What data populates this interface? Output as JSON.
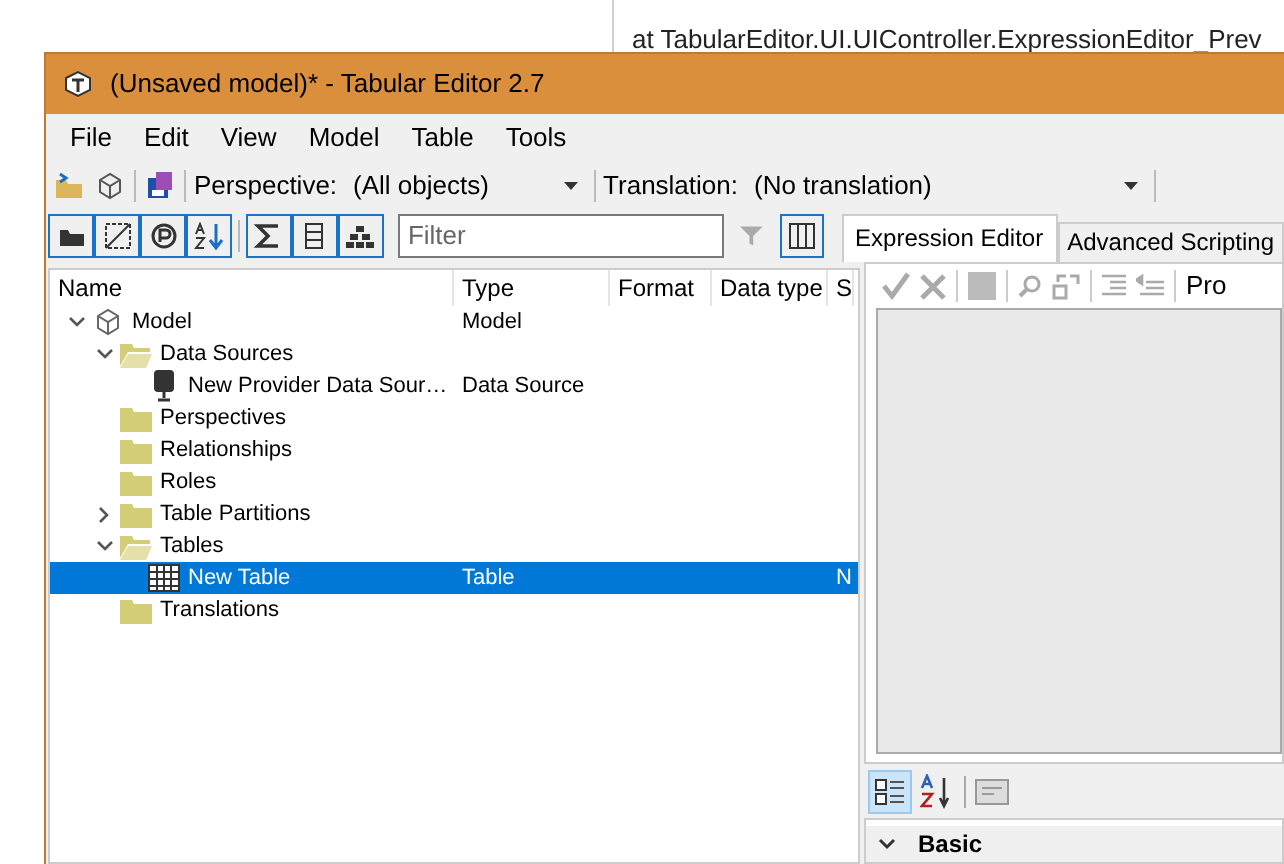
{
  "background_text": "at TabularEditor.UI.UIController.ExpressionEditor_Prev",
  "window": {
    "title": "(Unsaved model)* - Tabular Editor 2.7"
  },
  "menu": [
    "File",
    "Edit",
    "View",
    "Model",
    "Table",
    "Tools"
  ],
  "toolbar": {
    "perspective_label": "Perspective:",
    "perspective_value": "(All objects)",
    "translation_label": "Translation:",
    "translation_value": "(No translation)"
  },
  "filter": {
    "placeholder": "Filter"
  },
  "tree": {
    "columns": [
      "Name",
      "Type",
      "Format",
      "Data type",
      "S"
    ],
    "nodes": [
      {
        "kind": "model",
        "name": "Model",
        "type": "Model",
        "expanded": true,
        "selected": false,
        "children": [
          {
            "kind": "folder",
            "name": "Data Sources",
            "expanded": true,
            "selected": false,
            "children": [
              {
                "kind": "datasource",
                "name": "New Provider Data Sour…",
                "type": "Data Source",
                "selected": false
              }
            ]
          },
          {
            "kind": "folder",
            "name": "Perspectives",
            "selected": false
          },
          {
            "kind": "folder",
            "name": "Relationships",
            "selected": false
          },
          {
            "kind": "folder",
            "name": "Roles",
            "selected": false
          },
          {
            "kind": "folder",
            "name": "Table Partitions",
            "expanded": false,
            "selected": false
          },
          {
            "kind": "folder",
            "name": "Tables",
            "expanded": true,
            "selected": false,
            "children": [
              {
                "kind": "table",
                "name": "New Table",
                "type": "Table",
                "column_5": "N",
                "selected": true
              }
            ]
          },
          {
            "kind": "folder",
            "name": "Translations",
            "selected": false
          }
        ]
      }
    ]
  },
  "tabs": [
    {
      "label": "Expression Editor",
      "selected": true
    },
    {
      "label": "Advanced Scripting",
      "selected": false
    }
  ],
  "expression_toolbar": {
    "text": "Pro"
  },
  "properties": {
    "categorized_selected": true,
    "categories": [
      {
        "name": "Basic",
        "expanded": true
      }
    ]
  }
}
